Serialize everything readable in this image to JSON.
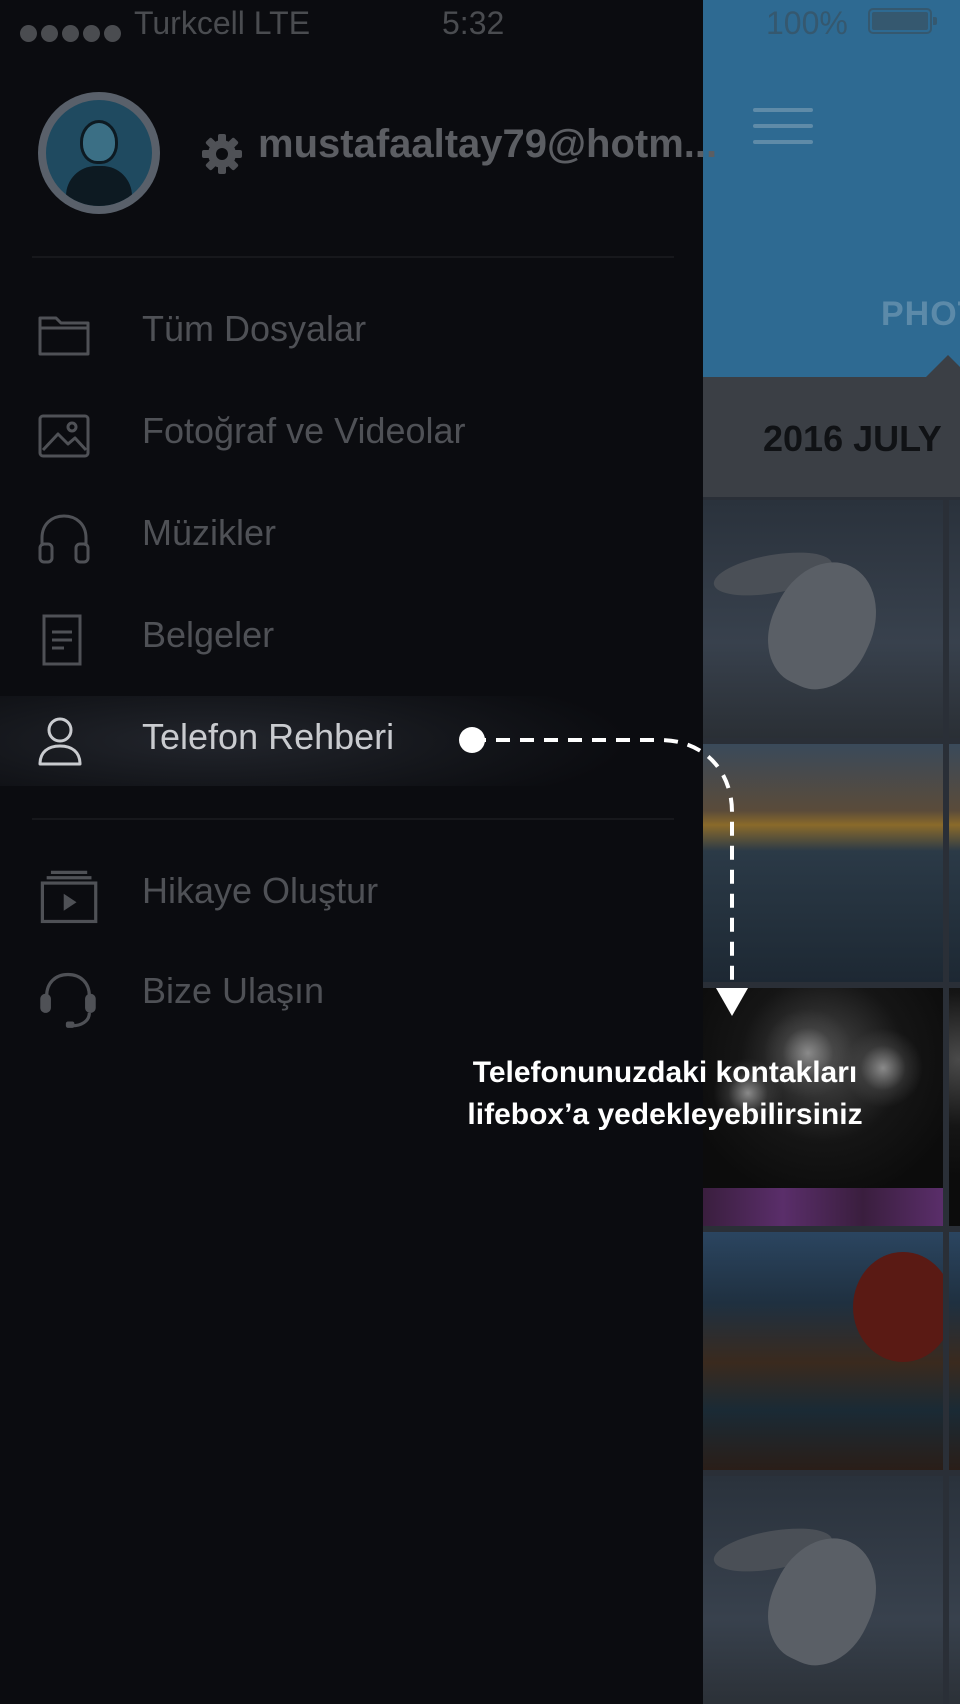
{
  "status_bar": {
    "carrier": "Turkcell  LTE",
    "time": "5:32",
    "battery": "100%"
  },
  "account": {
    "email": "mustafaaltay79@hotm..."
  },
  "menu": {
    "items": [
      {
        "label": "Tüm Dosyalar",
        "icon": "folder-icon"
      },
      {
        "label": "Fotoğraf ve Videolar",
        "icon": "image-icon"
      },
      {
        "label": "Müzikler",
        "icon": "headphones-icon"
      },
      {
        "label": "Belgeler",
        "icon": "document-icon"
      },
      {
        "label": "Telefon Rehberi",
        "icon": "person-icon",
        "active": true
      }
    ],
    "secondary": [
      {
        "label": "Hikaye Oluştur",
        "icon": "story-play-icon"
      },
      {
        "label": "Bize Ulaşın",
        "icon": "headset-icon"
      }
    ]
  },
  "background_app": {
    "tab": "PHOT",
    "date_label": "2016 JULY"
  },
  "tooltip": {
    "line1": "Telefonunuzdaki kontakları",
    "line2": "lifebox’a yedekleyebilirsiniz"
  },
  "colors": {
    "drawer_bg": "#0b0c10",
    "header_blue": "#2e6a92",
    "menu_text": "#4f5156",
    "menu_text_active": "#c9cbcf",
    "tooltip_text": "#ffffff"
  }
}
